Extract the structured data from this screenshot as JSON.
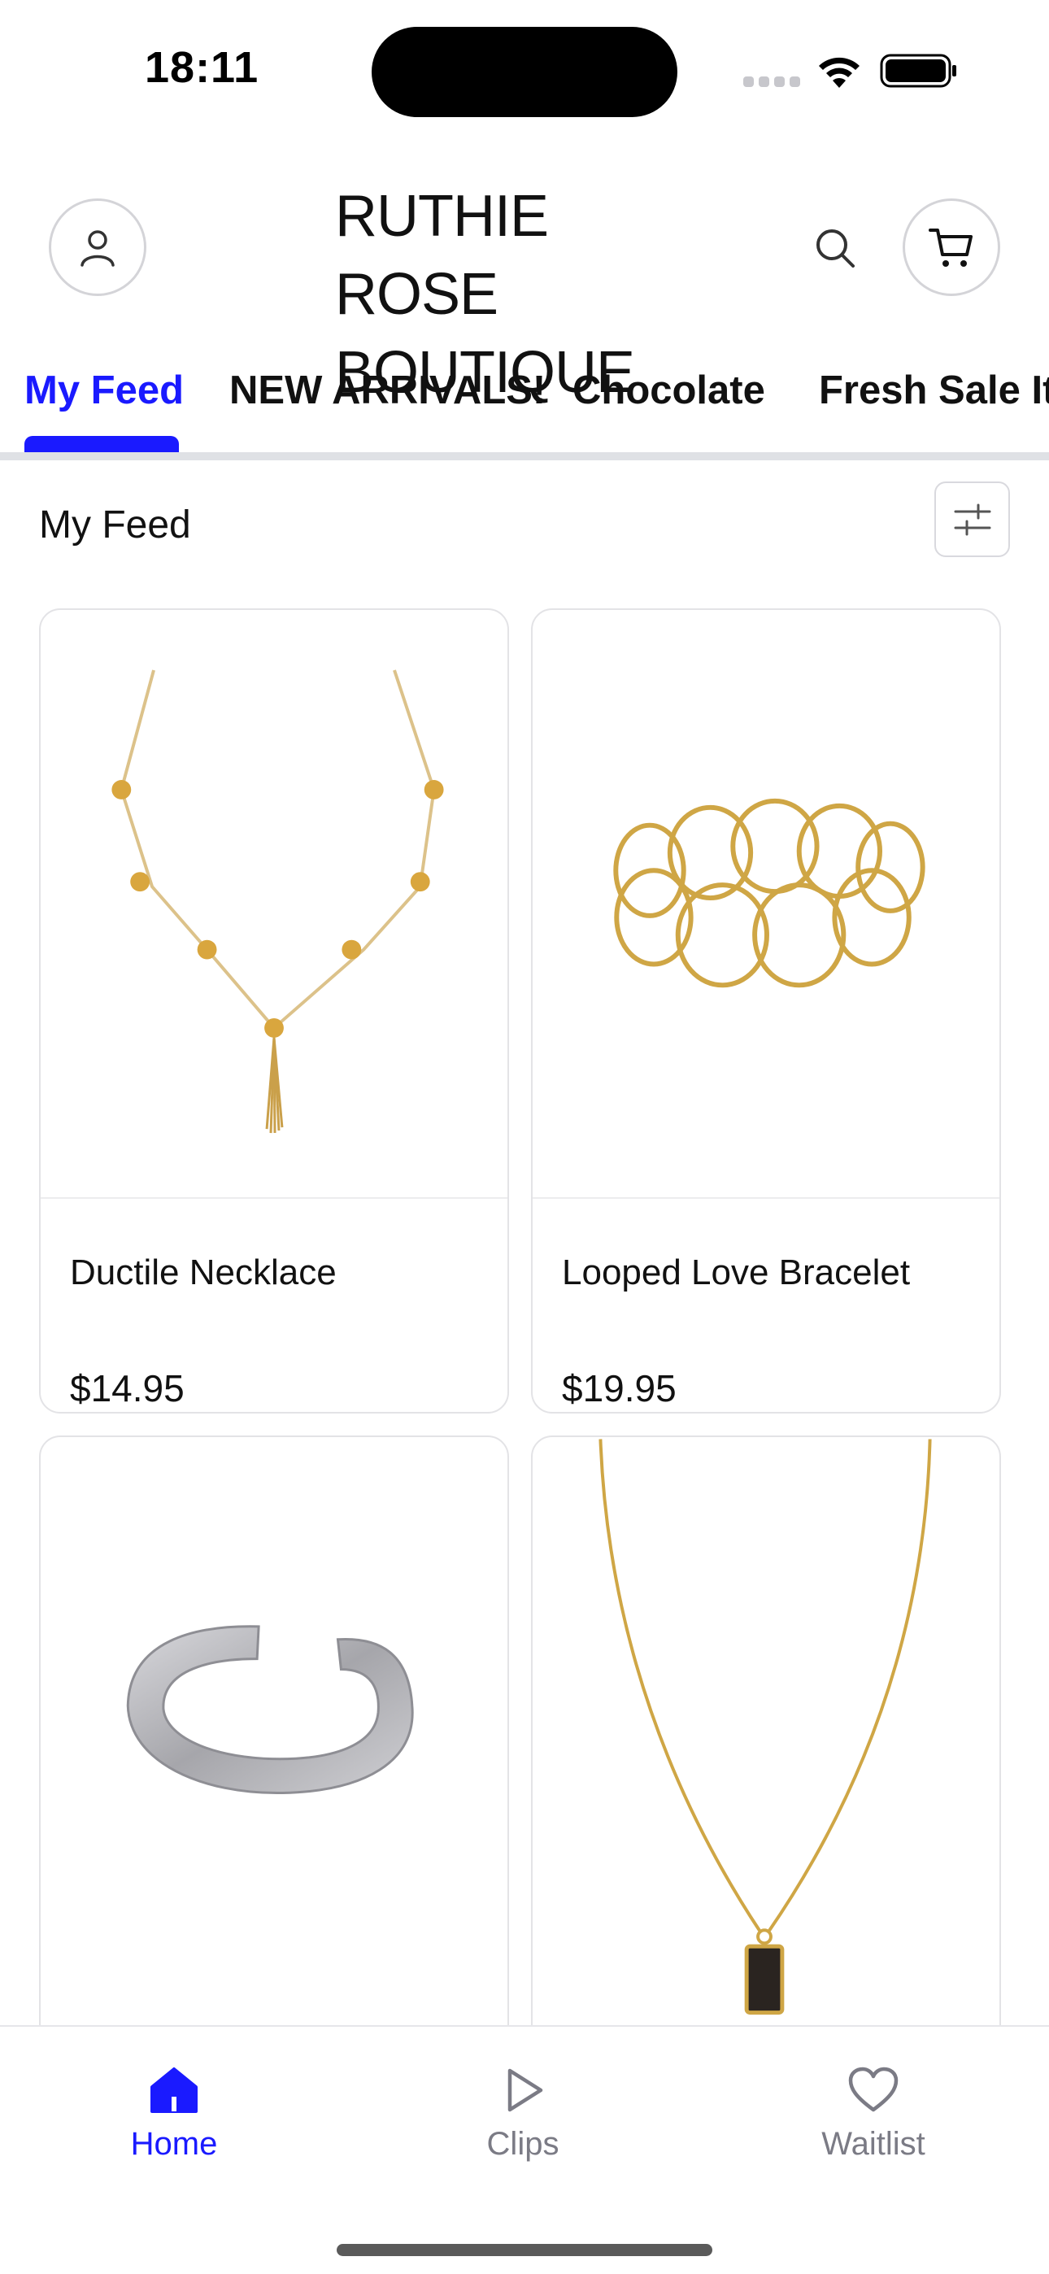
{
  "status_bar": {
    "time": "18:11"
  },
  "header": {
    "brand_line1": "RUTHIE ROSE",
    "brand_line2": "BOUTIQUE",
    "icons": {
      "profile": "user-icon",
      "search": "search-icon",
      "cart": "cart-icon"
    }
  },
  "tabs": [
    {
      "label": "My Feed",
      "active": true
    },
    {
      "label": "NEW ARRIVALS!",
      "active": false
    },
    {
      "label": "Chocolate",
      "active": false
    },
    {
      "label": "Fresh Sale Ite",
      "active": false
    }
  ],
  "section": {
    "title": "My Feed",
    "filter_icon": "sliders-icon"
  },
  "products": [
    {
      "name": "Ductile Necklace",
      "price": "$14.95",
      "image": "gold-flower-necklace"
    },
    {
      "name": "Looped Love Bracelet",
      "price": "$19.95",
      "image": "gold-loop-bracelet"
    },
    {
      "name": "",
      "price": "",
      "image": "silver-cuff-bracelet"
    },
    {
      "name": "",
      "price": "",
      "image": "gold-pendant-necklace"
    }
  ],
  "bottom_nav": [
    {
      "label": "Home",
      "icon": "home-icon",
      "active": true
    },
    {
      "label": "Clips",
      "icon": "play-icon",
      "active": false
    },
    {
      "label": "Waitlist",
      "icon": "heart-icon",
      "active": false
    }
  ],
  "colors": {
    "accent": "#1a1aff",
    "gold": "#d4a94a",
    "silver": "#a8a8ad"
  }
}
